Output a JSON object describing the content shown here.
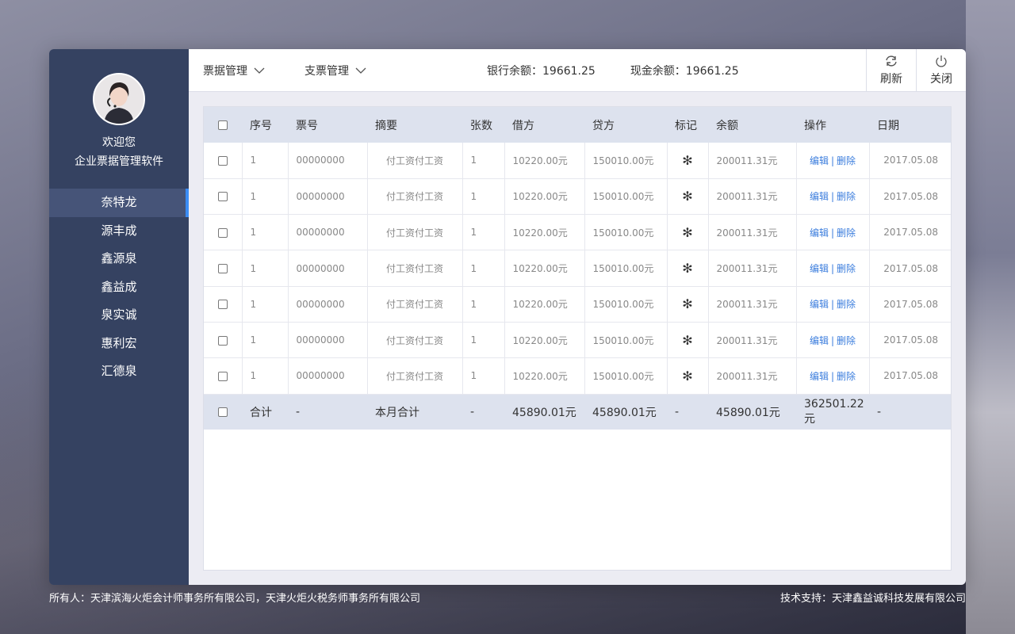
{
  "sidebar": {
    "welcome_line1": "欢迎您",
    "welcome_line2": "企业票据管理软件",
    "items": [
      {
        "label": "奈特龙"
      },
      {
        "label": "源丰成"
      },
      {
        "label": "鑫源泉"
      },
      {
        "label": "鑫益成"
      },
      {
        "label": "泉实诚"
      },
      {
        "label": "惠利宏"
      },
      {
        "label": "汇德泉"
      }
    ],
    "active_index": 0
  },
  "topbar": {
    "menu1": "票据管理",
    "menu2": "支票管理",
    "bank_balance": "银行余额：19661.25",
    "cash_balance": "现金余额：19661.25",
    "refresh": "刷新",
    "close": "关闭"
  },
  "table": {
    "headers": [
      "序号",
      "票号",
      "摘要",
      "张数",
      "借方",
      "贷方",
      "标记",
      "余额",
      "操作",
      "日期"
    ],
    "rows": [
      {
        "seq": "1",
        "no": "00000000",
        "summary": "付工资付工资",
        "count": "1",
        "debit": "10220.00元",
        "credit": "150010.00元",
        "mark": "✻",
        "balance": "200011.31元",
        "edit": "编辑",
        "sep": "|",
        "del": "删除",
        "date": "2017.05.08"
      },
      {
        "seq": "1",
        "no": "00000000",
        "summary": "付工资付工资",
        "count": "1",
        "debit": "10220.00元",
        "credit": "150010.00元",
        "mark": "✻",
        "balance": "200011.31元",
        "edit": "编辑",
        "sep": "|",
        "del": "删除",
        "date": "2017.05.08"
      },
      {
        "seq": "1",
        "no": "00000000",
        "summary": "付工资付工资",
        "count": "1",
        "debit": "10220.00元",
        "credit": "150010.00元",
        "mark": "✻",
        "balance": "200011.31元",
        "edit": "编辑",
        "sep": "|",
        "del": "删除",
        "date": "2017.05.08"
      },
      {
        "seq": "1",
        "no": "00000000",
        "summary": "付工资付工资",
        "count": "1",
        "debit": "10220.00元",
        "credit": "150010.00元",
        "mark": "✻",
        "balance": "200011.31元",
        "edit": "编辑",
        "sep": "|",
        "del": "删除",
        "date": "2017.05.08"
      },
      {
        "seq": "1",
        "no": "00000000",
        "summary": "付工资付工资",
        "count": "1",
        "debit": "10220.00元",
        "credit": "150010.00元",
        "mark": "✻",
        "balance": "200011.31元",
        "edit": "编辑",
        "sep": "|",
        "del": "删除",
        "date": "2017.05.08"
      },
      {
        "seq": "1",
        "no": "00000000",
        "summary": "付工资付工资",
        "count": "1",
        "debit": "10220.00元",
        "credit": "150010.00元",
        "mark": "✻",
        "balance": "200011.31元",
        "edit": "编辑",
        "sep": "|",
        "del": "删除",
        "date": "2017.05.08"
      },
      {
        "seq": "1",
        "no": "00000000",
        "summary": "付工资付工资",
        "count": "1",
        "debit": "10220.00元",
        "credit": "150010.00元",
        "mark": "✻",
        "balance": "200011.31元",
        "edit": "编辑",
        "sep": "|",
        "del": "删除",
        "date": "2017.05.08"
      }
    ],
    "total": {
      "seq": "合计",
      "no": "-",
      "summary": "本月合计",
      "count": "-",
      "debit": "45890.01元",
      "credit": "45890.01元",
      "mark": "-",
      "balance": "45890.01元",
      "ops": "362501.22元",
      "date": "-"
    }
  },
  "footer": {
    "owner": "所有人：天津滨海火炬会计师事务所有限公司，天津火炬火税务师事务所有限公司",
    "support": "技术支持：天津鑫益诚科技发展有限公司"
  },
  "colors": {
    "sidebar_bg": "#354261",
    "active_item_bg": "#465478",
    "accent": "#3b8cf4",
    "header_bg": "#dde2ee",
    "link": "#3b7ddd"
  }
}
